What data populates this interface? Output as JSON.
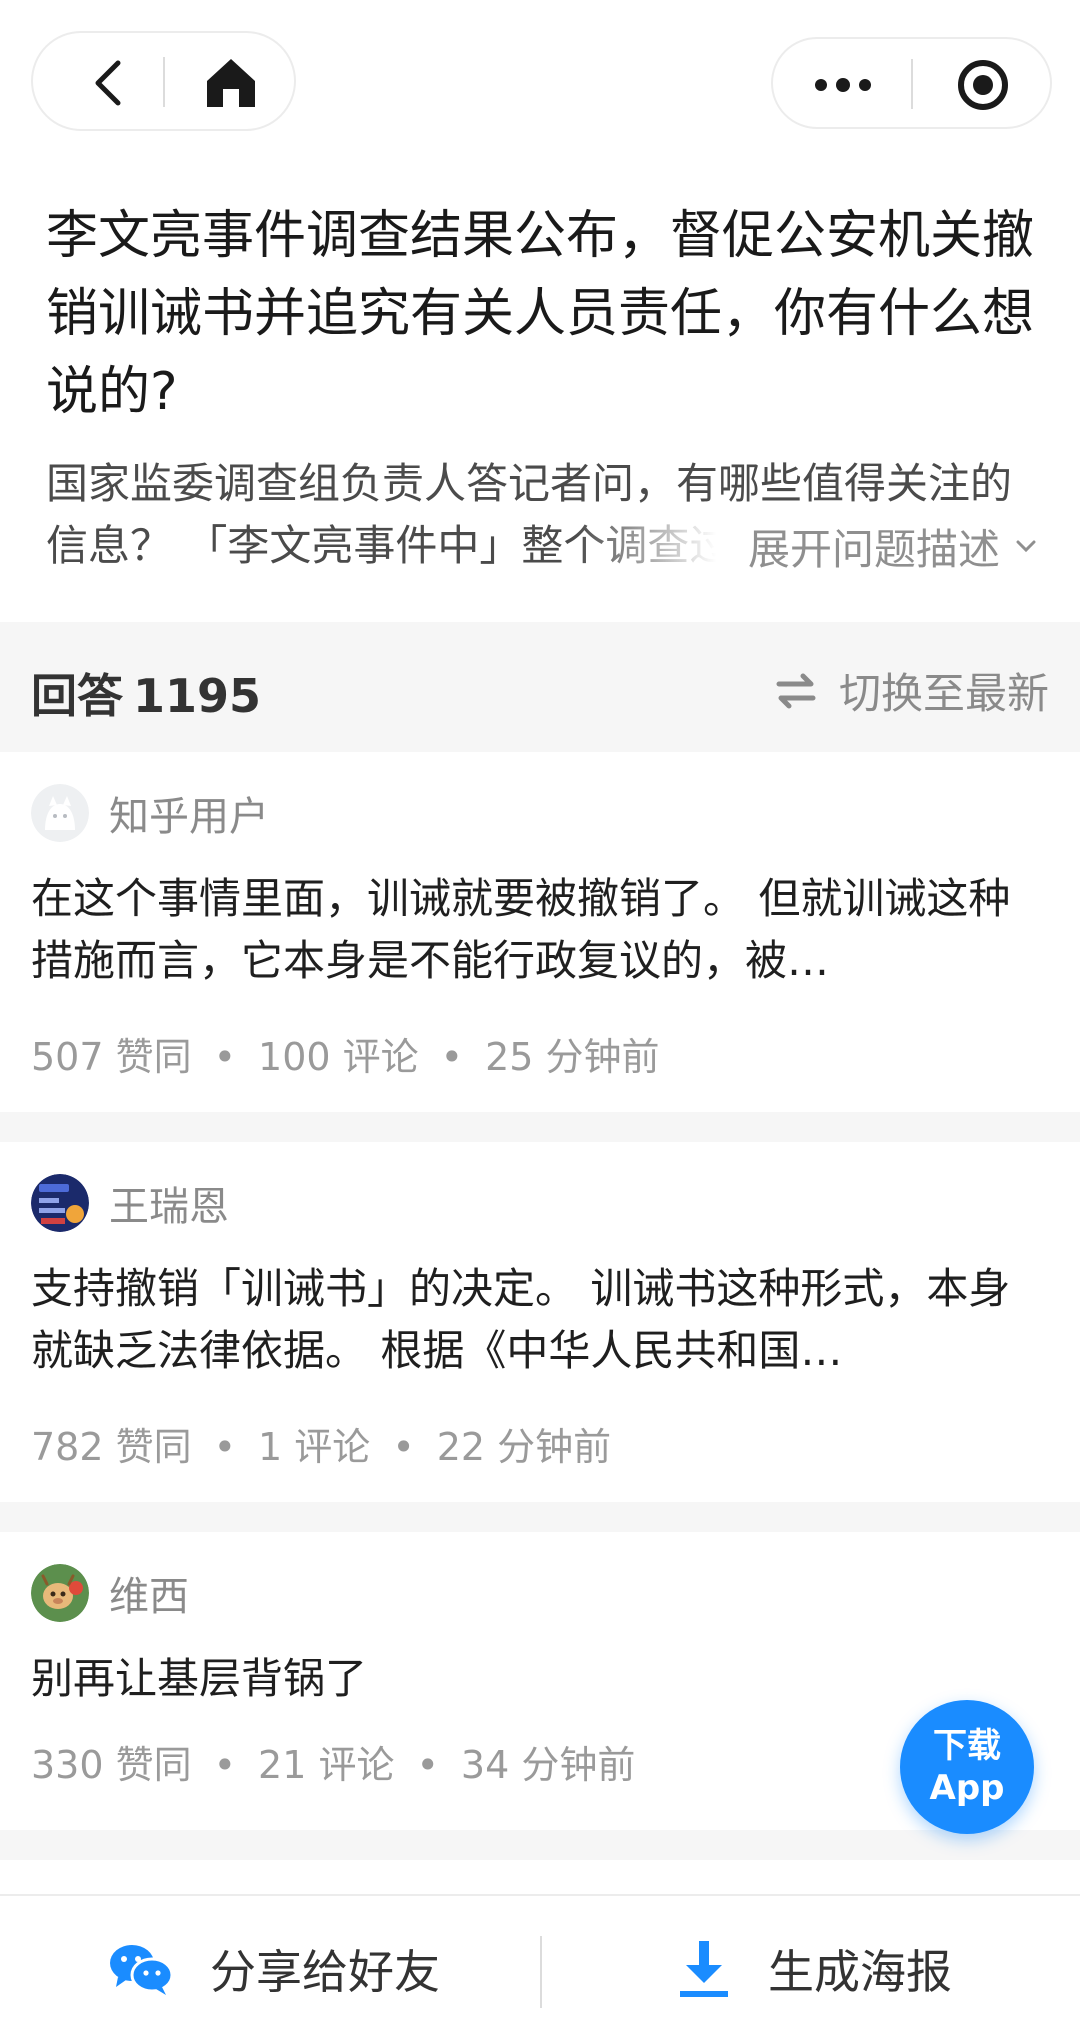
{
  "topbar": {
    "back_icon": "chevron-left-icon",
    "home_icon": "home-icon",
    "more_icon": "more-dots-icon",
    "close_icon": "target-circle-icon"
  },
  "question": {
    "title": "李文亮事件调查结果公布，督促公安机关撤销训诫书并追究有关人员责任，你有什么想说的?",
    "description": "国家监委调查组负责人答记者问，有哪些值得关注的信息？ 「李文亮事件中」整个调查过程",
    "expand_label": "展开问题描述"
  },
  "answers_header": {
    "label": "回答",
    "count": "1195",
    "switch_label": "切换至最新"
  },
  "answers": [
    {
      "author": "知乎用户",
      "excerpt": "在这个事情里面，训诫就要被撤销了。 但就训诫这种措施而言，它本身是不能行政复议的，被…",
      "likes": "507 赞同",
      "comments": "100 评论",
      "time": "25 分钟前"
    },
    {
      "author": "王瑞恩",
      "excerpt": "支持撤销「训诫书」的决定。 训诫书这种形式，本身就缺乏法律依据。 根据《中华人民共和国…",
      "likes": "782 赞同",
      "comments": "1 评论",
      "time": "22 分钟前"
    },
    {
      "author": "维西",
      "excerpt": "别再让基层背锅了",
      "likes": "330 赞同",
      "comments": "21 评论",
      "time": "34 分钟前"
    }
  ],
  "fab": {
    "line1": "下载",
    "line2": "App"
  },
  "bottom_bar": {
    "share_label": "分享给好友",
    "poster_label": "生成海报"
  },
  "colors": {
    "accent": "#1a8cff",
    "wechat_green": "#2aae67",
    "section_bg": "#f6f6f6"
  },
  "meta_separator": "•"
}
